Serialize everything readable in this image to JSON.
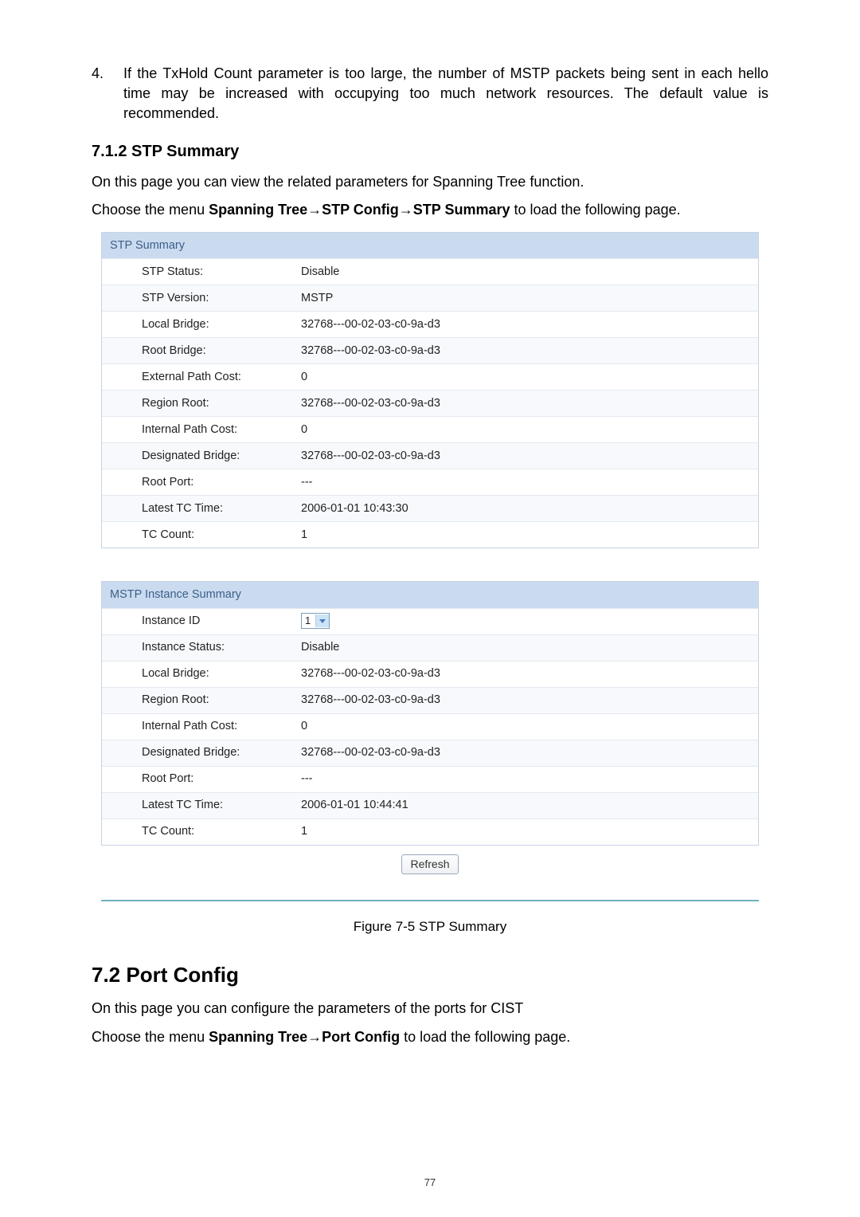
{
  "listItem4": {
    "number": "4.",
    "text": "If the TxHold Count parameter is too large, the number of MSTP packets being sent in each hello time may be increased with occupying too much network resources. The default value is recommended."
  },
  "heading712": "7.1.2 STP Summary",
  "para1": "On this page you can view the related parameters for Spanning Tree function.",
  "para2_pre": "Choose the menu ",
  "para2_bold": "Spanning Tree→STP Config→STP Summary",
  "para2_post": " to load the following page.",
  "stpSummary": {
    "title": "STP Summary",
    "rows": [
      {
        "label": "STP Status:",
        "value": "Disable"
      },
      {
        "label": "STP Version:",
        "value": "MSTP"
      },
      {
        "label": "Local Bridge:",
        "value": "32768---00-02-03-c0-9a-d3"
      },
      {
        "label": "Root Bridge:",
        "value": "32768---00-02-03-c0-9a-d3"
      },
      {
        "label": "External Path Cost:",
        "value": "0"
      },
      {
        "label": "Region Root:",
        "value": "32768---00-02-03-c0-9a-d3"
      },
      {
        "label": "Internal Path Cost:",
        "value": "0"
      },
      {
        "label": "Designated Bridge:",
        "value": "32768---00-02-03-c0-9a-d3"
      },
      {
        "label": "Root Port:",
        "value": "---"
      },
      {
        "label": "Latest TC Time:",
        "value": "2006-01-01 10:43:30"
      },
      {
        "label": "TC Count:",
        "value": "1"
      }
    ]
  },
  "mstpSummary": {
    "title": "MSTP Instance Summary",
    "instanceIdLabel": "Instance ID",
    "instanceIdValue": "1",
    "rows": [
      {
        "label": "Instance Status:",
        "value": "Disable"
      },
      {
        "label": "Local Bridge:",
        "value": "32768---00-02-03-c0-9a-d3"
      },
      {
        "label": "Region Root:",
        "value": "32768---00-02-03-c0-9a-d3"
      },
      {
        "label": "Internal Path Cost:",
        "value": "0"
      },
      {
        "label": "Designated Bridge:",
        "value": "32768---00-02-03-c0-9a-d3"
      },
      {
        "label": "Root Port:",
        "value": "---"
      },
      {
        "label": "Latest TC Time:",
        "value": "2006-01-01 10:44:41"
      },
      {
        "label": "TC Count:",
        "value": "1"
      }
    ]
  },
  "refreshLabel": "Refresh",
  "figCaption": "Figure 7-5 STP Summary",
  "heading72": "7.2  Port Config",
  "para3": "On this page you can configure the parameters of the ports for CIST",
  "para4_pre": "Choose the menu ",
  "para4_bold": "Spanning Tree→Port Config",
  "para4_post": " to load the following page.",
  "pageNumber": "77"
}
